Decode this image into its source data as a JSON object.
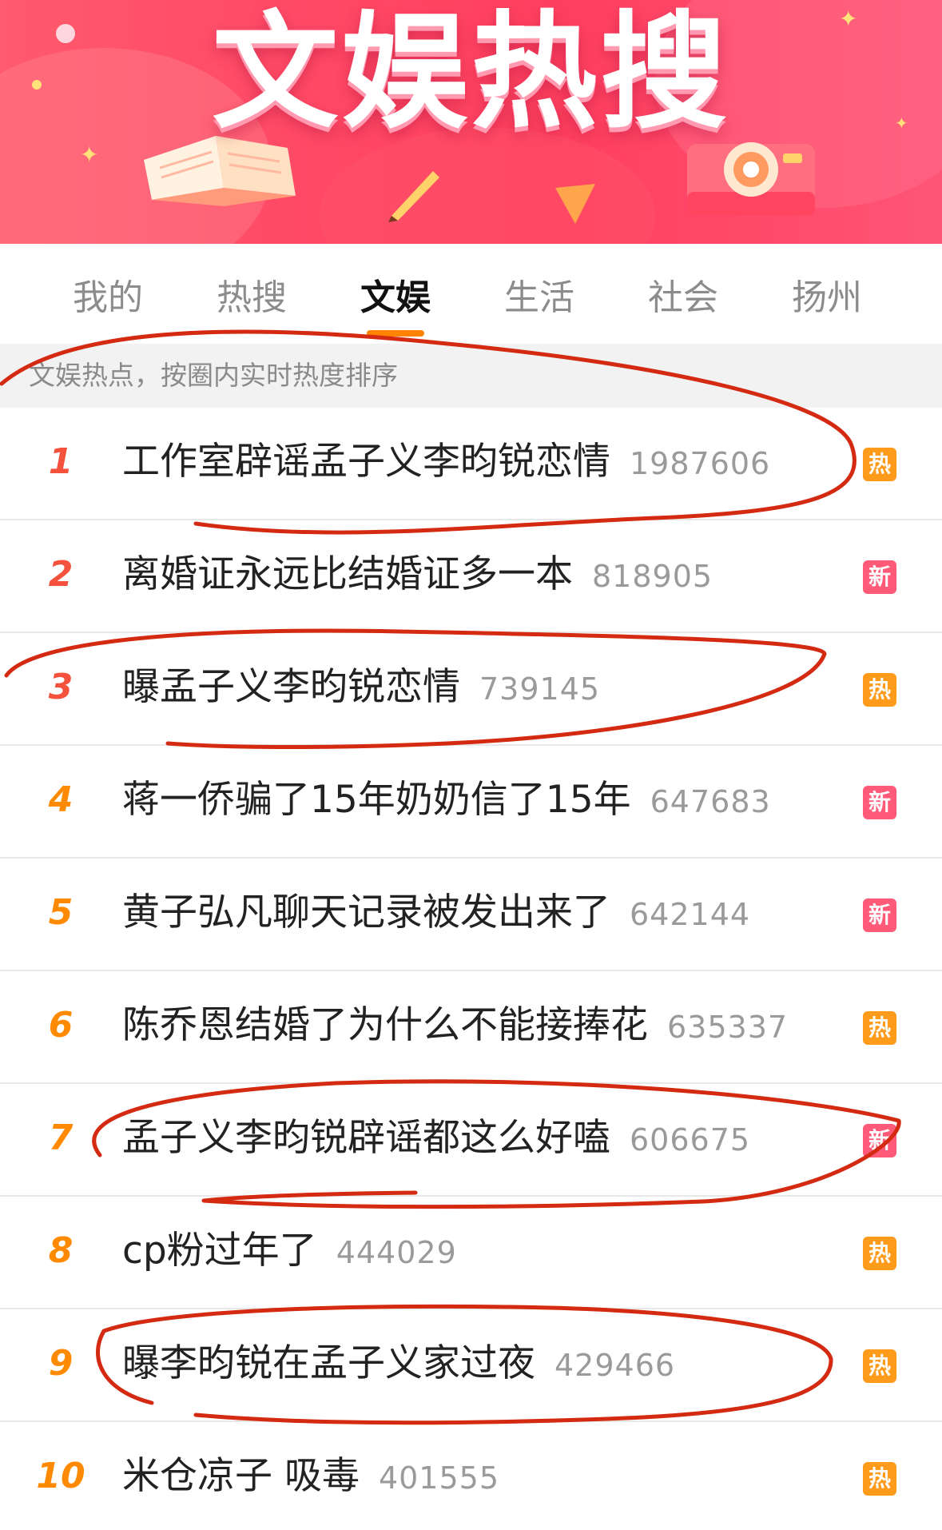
{
  "banner": {
    "title": "文娱热搜",
    "colors": {
      "background": "#ff4a66",
      "title": "#ffffff"
    },
    "decor": [
      "book-icon",
      "camera-icon",
      "sparkle-icon",
      "pencil-icon"
    ]
  },
  "tabs": [
    {
      "label": "我的",
      "active": false
    },
    {
      "label": "热搜",
      "active": false
    },
    {
      "label": "文娱",
      "active": true
    },
    {
      "label": "生活",
      "active": false
    },
    {
      "label": "社会",
      "active": false
    },
    {
      "label": "扬州",
      "active": false
    }
  ],
  "accent_color": "#ff8200",
  "subheader": {
    "text": "文娱热点，按圈内实时热度排序"
  },
  "list": {
    "items": [
      {
        "rank": "1",
        "title": "工作室辟谣孟子义李昀锐恋情",
        "count": "1987606",
        "badge": "热",
        "badge_type": "hot"
      },
      {
        "rank": "2",
        "title": "离婚证永远比结婚证多一本",
        "count": "818905",
        "badge": "新",
        "badge_type": "new"
      },
      {
        "rank": "3",
        "title": "曝孟子义李昀锐恋情",
        "count": "739145",
        "badge": "热",
        "badge_type": "hot"
      },
      {
        "rank": "4",
        "title": "蒋一侨骗了15年奶奶信了15年",
        "count": "647683",
        "badge": "新",
        "badge_type": "new"
      },
      {
        "rank": "5",
        "title": "黄子弘凡聊天记录被发出来了",
        "count": "642144",
        "badge": "新",
        "badge_type": "new"
      },
      {
        "rank": "6",
        "title": "陈乔恩结婚了为什么不能接捧花",
        "count": "635337",
        "badge": "热",
        "badge_type": "hot"
      },
      {
        "rank": "7",
        "title": "孟子义李昀锐辟谣都这么好嗑",
        "count": "606675",
        "badge": "新",
        "badge_type": "new"
      },
      {
        "rank": "8",
        "title": "cp粉过年了",
        "count": "444029",
        "badge": "热",
        "badge_type": "hot"
      },
      {
        "rank": "9",
        "title": "曝李昀锐在孟子义家过夜",
        "count": "429466",
        "badge": "热",
        "badge_type": "hot"
      },
      {
        "rank": "10",
        "title": "米仓凉子 吸毒",
        "count": "401555",
        "badge": "热",
        "badge_type": "hot"
      }
    ]
  },
  "rank_colors": {
    "top3": "#f4523d",
    "rest": "#ff8a00"
  },
  "badge_colors": {
    "hot": "#ff9b1b",
    "new": "#ff5a78"
  },
  "annotation_color": "#d42a12"
}
